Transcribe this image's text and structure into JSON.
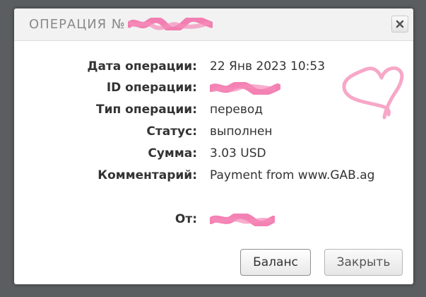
{
  "modal": {
    "title": "ОПЕРАЦИЯ №",
    "close_icon": "close-icon"
  },
  "details": {
    "date": {
      "label": "Дата операции:",
      "value": "22 Янв 2023 10:53"
    },
    "id": {
      "label": "ID операции:"
    },
    "type": {
      "label": "Тип операции:",
      "value": "перевод"
    },
    "status": {
      "label": "Статус:",
      "value": "выполнен"
    },
    "amount": {
      "label": "Сумма:",
      "value": "3.03 USD"
    },
    "comment": {
      "label": "Комментарий:",
      "value": "Payment from www.GAB.ag"
    },
    "from": {
      "label": "От:"
    }
  },
  "buttons": {
    "balance": "Баланс",
    "close": "Закрыть"
  },
  "colors": {
    "redaction_pink": "#f26ba6",
    "heart_pink": "#f7a7c7"
  }
}
